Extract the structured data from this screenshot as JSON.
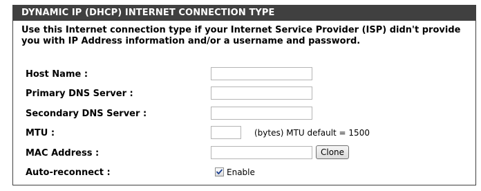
{
  "section": {
    "title": "DYNAMIC IP (DHCP) INTERNET CONNECTION TYPE",
    "description": "Use this Internet connection type if your Internet Service Provider (ISP) didn't provide you with IP Address information and/or a username and password."
  },
  "fields": {
    "host_name": {
      "label": "Host Name :",
      "value": ""
    },
    "primary_dns": {
      "label": "Primary DNS Server :",
      "value": ""
    },
    "secondary_dns": {
      "label": "Secondary DNS Server :",
      "value": ""
    },
    "mtu": {
      "label": "MTU :",
      "value": "",
      "hint": "(bytes) MTU default = 1500"
    },
    "mac_address": {
      "label": "MAC Address :",
      "value": "",
      "clone_label": "Clone"
    },
    "auto_reconnect": {
      "label": "Auto-reconnect :",
      "checkbox_label": "Enable",
      "checked": true
    }
  },
  "colors": {
    "header_bg": "#404040",
    "header_text": "#ffffff",
    "checkmark": "#1b3f8f"
  }
}
